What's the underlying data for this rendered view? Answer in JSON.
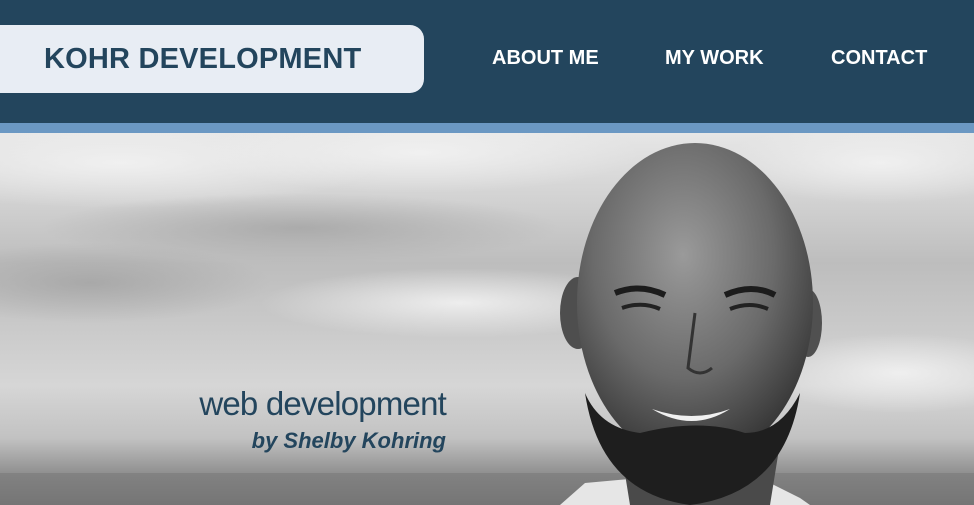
{
  "header": {
    "brand": "KOHR DEVELOPMENT",
    "nav": [
      {
        "label": "ABOUT ME"
      },
      {
        "label": "MY WORK"
      },
      {
        "label": "CONTACT"
      }
    ]
  },
  "hero": {
    "tagline": "web development",
    "byline": "by Shelby Kohring",
    "image": "portrait-photo"
  },
  "colors": {
    "header_bg": "#23455d",
    "brand_pill_bg": "#e8edf4",
    "accent_stripe": "#6b98c3",
    "nav_text": "#ffffff"
  }
}
